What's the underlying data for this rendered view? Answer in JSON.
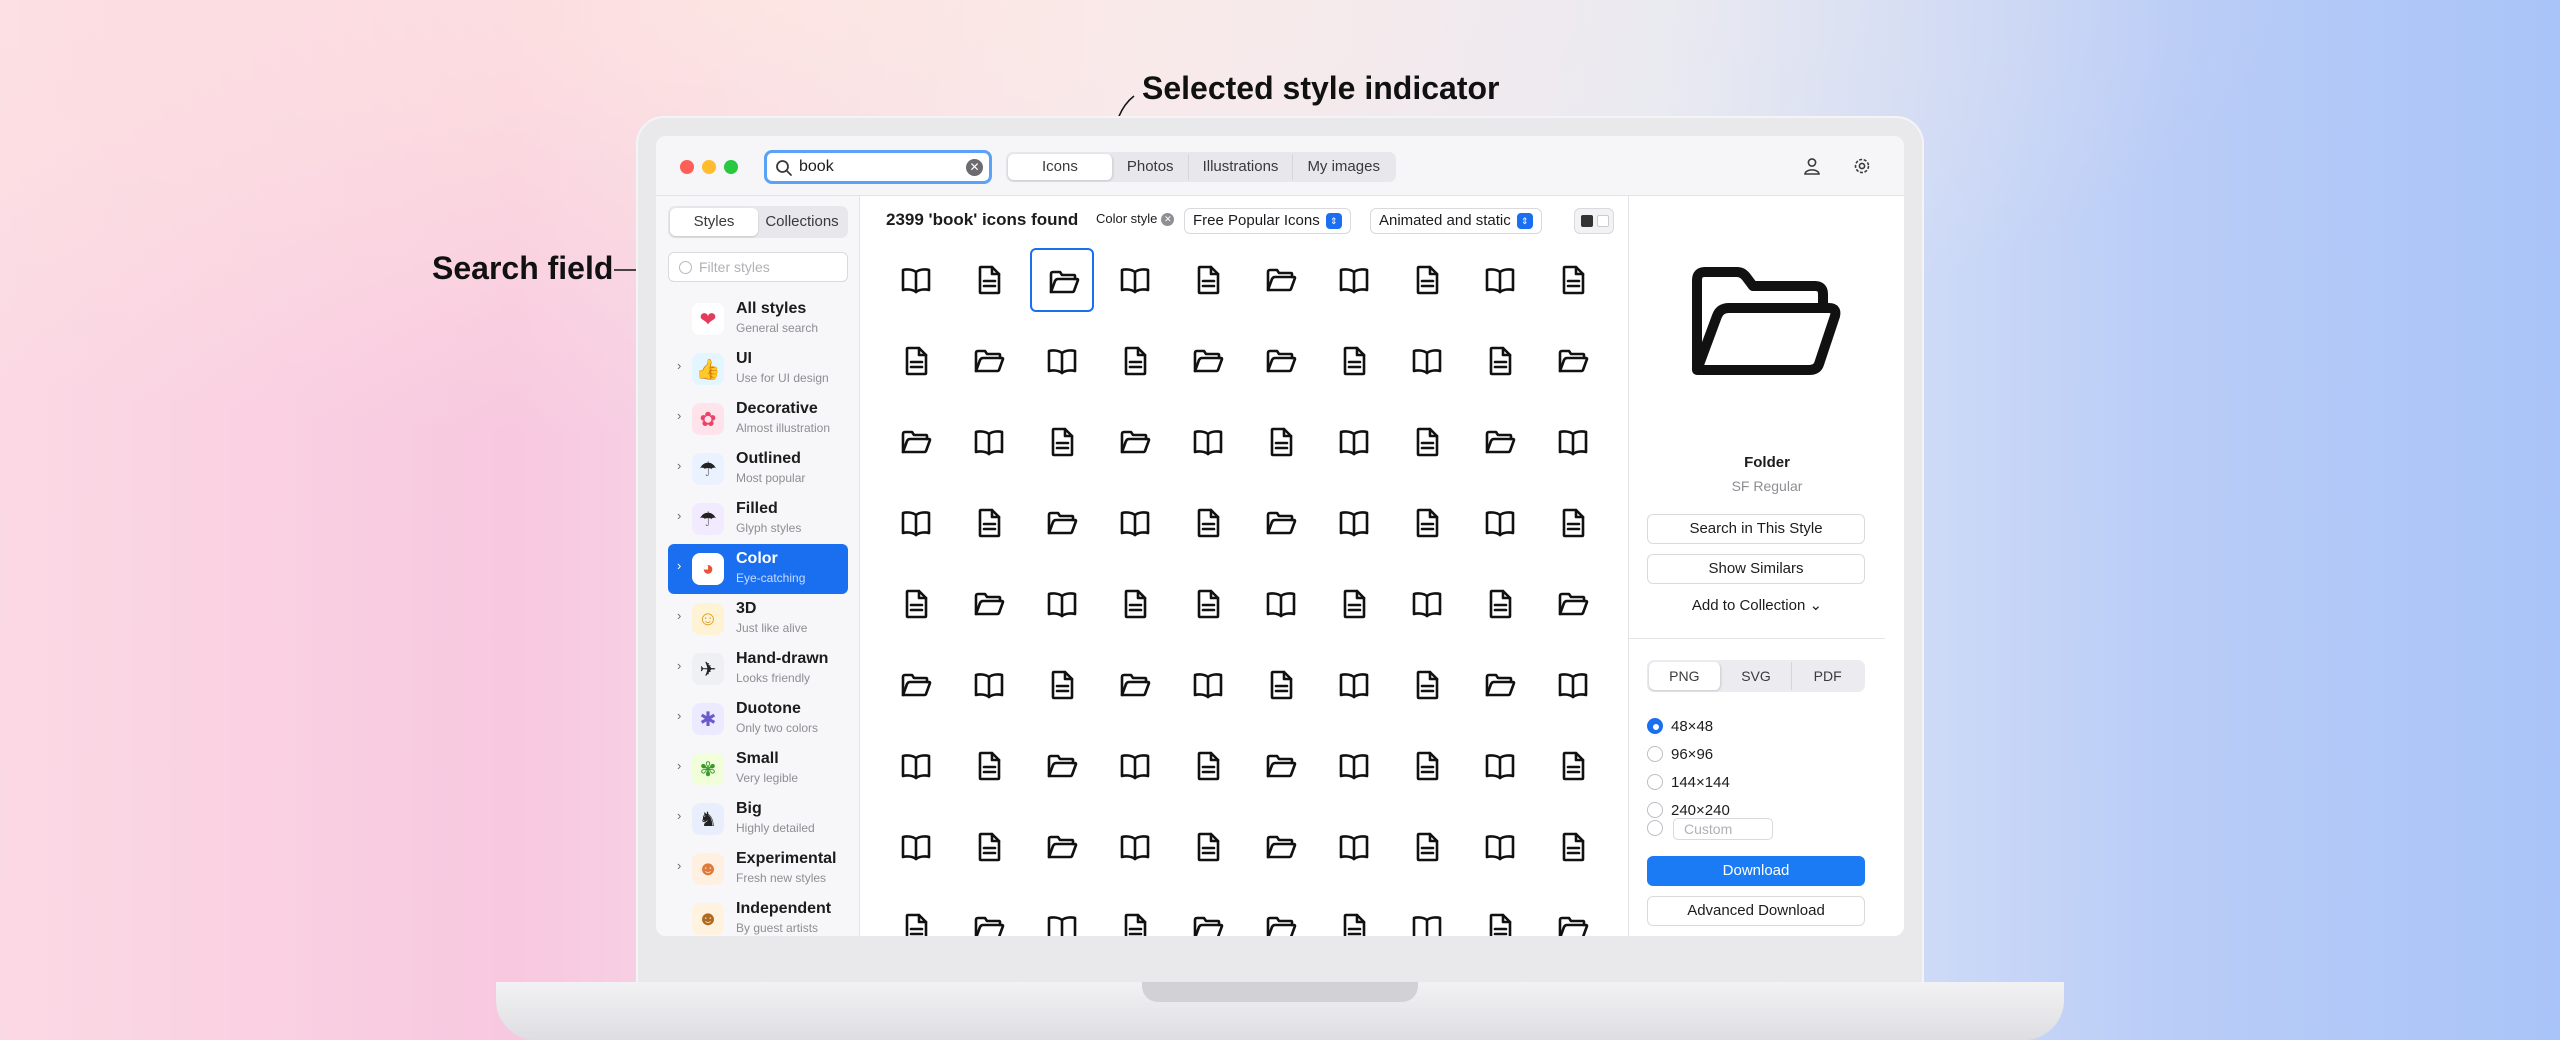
{
  "annotations": {
    "search_field": "Search field",
    "selected_style": "Selected style indicator"
  },
  "toolbar": {
    "search_value": "book",
    "tabs": [
      {
        "label": "Icons",
        "active": true
      },
      {
        "label": "Photos",
        "active": false
      },
      {
        "label": "Illustrations",
        "active": false
      },
      {
        "label": "My images",
        "active": false
      }
    ],
    "account_icon": "person-icon",
    "settings_icon": "gear-icon"
  },
  "sidebar": {
    "tabs": [
      {
        "label": "Styles",
        "active": true
      },
      {
        "label": "Collections",
        "active": false
      }
    ],
    "filter_placeholder": "Filter styles",
    "items": [
      {
        "name": "All styles",
        "desc": "General search",
        "icon": "all-styles-icon",
        "has_chevron": false,
        "active": false
      },
      {
        "name": "UI",
        "desc": "Use for UI design",
        "icon": "thumbs-up-icon",
        "has_chevron": true,
        "active": false
      },
      {
        "name": "Decorative",
        "desc": "Almost illustration",
        "icon": "flower-icon",
        "has_chevron": true,
        "active": false
      },
      {
        "name": "Outlined",
        "desc": "Most popular",
        "icon": "umbrella-outline-icon",
        "has_chevron": true,
        "active": false
      },
      {
        "name": "Filled",
        "desc": "Glyph styles",
        "icon": "umbrella-filled-icon",
        "has_chevron": true,
        "active": false
      },
      {
        "name": "Color",
        "desc": "Eye-catching",
        "icon": "color-wheel-icon",
        "has_chevron": true,
        "active": true
      },
      {
        "name": "3D",
        "desc": "Just like alive",
        "icon": "smiley-3d-icon",
        "has_chevron": true,
        "active": false
      },
      {
        "name": "Hand-drawn",
        "desc": "Looks friendly",
        "icon": "paper-plane-icon",
        "has_chevron": true,
        "active": false
      },
      {
        "name": "Duotone",
        "desc": "Only two colors",
        "icon": "bee-icon",
        "has_chevron": true,
        "active": false
      },
      {
        "name": "Small",
        "desc": "Very legible",
        "icon": "frog-icon",
        "has_chevron": true,
        "active": false
      },
      {
        "name": "Big",
        "desc": "Highly detailed",
        "icon": "elephant-icon",
        "has_chevron": true,
        "active": false
      },
      {
        "name": "Experimental",
        "desc": "Fresh new styles",
        "icon": "cat-icon",
        "has_chevron": true,
        "active": false
      },
      {
        "name": "Independent",
        "desc": "By guest artists",
        "icon": "people-icon",
        "has_chevron": false,
        "active": false
      }
    ]
  },
  "results": {
    "count_text": "2399 'book' icons found",
    "filter_chip": "Color style",
    "dropdown_1": "Free Popular Icons",
    "dropdown_2": "Animated and static",
    "grid_rows": [
      [
        "book",
        "doc",
        "folder",
        "book",
        "doc",
        "folder",
        "book",
        "doc",
        "book",
        "doc"
      ],
      [
        "doc",
        "folder",
        "book",
        "doc",
        "folder",
        "folder",
        "doc",
        "book",
        "doc",
        "folder"
      ],
      [
        "folder",
        "book",
        "doc",
        "folder",
        "book",
        "doc",
        "book",
        "doc",
        "folder",
        "book"
      ],
      [
        "book",
        "doc",
        "folder",
        "book",
        "doc",
        "folder",
        "book",
        "doc",
        "book",
        "doc"
      ],
      [
        "doc",
        "folder",
        "book",
        "doc",
        "doc",
        "book",
        "doc",
        "book",
        "doc",
        "folder"
      ],
      [
        "folder",
        "book",
        "doc",
        "folder",
        "book",
        "doc",
        "book",
        "doc",
        "folder",
        "book"
      ],
      [
        "book",
        "doc",
        "folder",
        "book",
        "doc",
        "folder",
        "book",
        "doc",
        "book",
        "doc"
      ],
      [
        "book",
        "doc",
        "folder",
        "book",
        "doc",
        "folder",
        "book",
        "doc",
        "book",
        "doc"
      ],
      [
        "doc",
        "folder",
        "book",
        "doc",
        "folder",
        "folder",
        "doc",
        "book",
        "doc",
        "folder"
      ]
    ],
    "selected_index": [
      0,
      2
    ]
  },
  "detail": {
    "preview_icon": "folder-icon",
    "name": "Folder",
    "style": "SF Regular",
    "search_in_style": "Search in This Style",
    "show_similars": "Show Similars",
    "add_to_collection": "Add to Collection ⌄",
    "formats": [
      {
        "label": "PNG",
        "active": true
      },
      {
        "label": "SVG",
        "active": false
      },
      {
        "label": "PDF",
        "active": false
      }
    ],
    "sizes": [
      {
        "label": "48×48",
        "checked": true
      },
      {
        "label": "96×96",
        "checked": false
      },
      {
        "label": "144×144",
        "checked": false
      },
      {
        "label": "240×240",
        "checked": false
      }
    ],
    "custom_placeholder": "Custom",
    "download": "Download",
    "advanced_download": "Advanced Download"
  },
  "colors": {
    "accent": "#1a6ff0",
    "search_focus": "#5aa2f5",
    "close": "#ff5f57",
    "minimize": "#febc2e",
    "zoom": "#28c840"
  }
}
